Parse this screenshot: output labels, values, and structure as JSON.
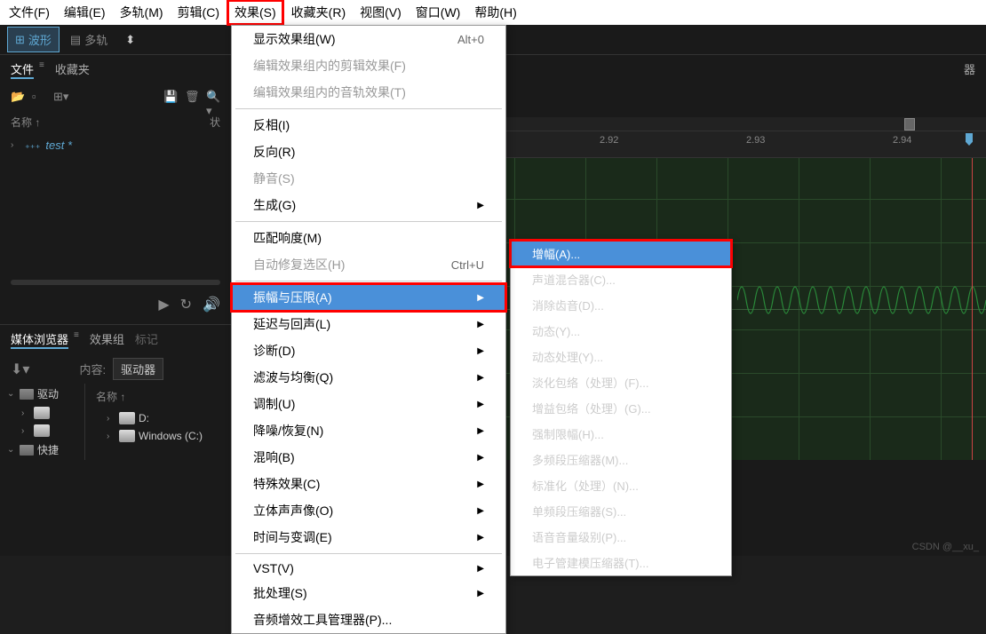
{
  "menubar": {
    "items": [
      {
        "label": "文件(F)"
      },
      {
        "label": "编辑(E)"
      },
      {
        "label": "多轨(M)"
      },
      {
        "label": "剪辑(C)"
      },
      {
        "label": "效果(S)",
        "highlighted": true
      },
      {
        "label": "收藏夹(R)"
      },
      {
        "label": "视图(V)"
      },
      {
        "label": "窗口(W)"
      },
      {
        "label": "帮助(H)"
      }
    ]
  },
  "toolbar": {
    "waveform_label": "波形",
    "multitrack_label": "多轨"
  },
  "files_panel": {
    "tab_files": "文件",
    "tab_favorites": "收藏夹",
    "name_header": "名称 ↑",
    "status_header": "状",
    "file_name": "test *",
    "expand": "›"
  },
  "browser": {
    "tab_media": "媒体浏览器",
    "tab_effects": "效果组",
    "tab_markers": "标记",
    "download_icon": "download",
    "content_label": "内容:",
    "content_value": "驱动器",
    "name_header": "名称 ↑",
    "tree": {
      "drivers_label": "驱动",
      "d_label": "D:",
      "c_label": "Windows (C:)",
      "shortcuts_label": "快捷"
    }
  },
  "editor": {
    "panel_label": "器",
    "ruler_ticks": [
      "2.92",
      "2.93",
      "2.94"
    ]
  },
  "effects_menu": {
    "items": [
      {
        "label": "显示效果组(W)",
        "accel": "Alt+0"
      },
      {
        "label": "编辑效果组内的剪辑效果(F)",
        "disabled": true
      },
      {
        "label": "编辑效果组内的音轨效果(T)",
        "disabled": true
      },
      {
        "sep": true
      },
      {
        "label": "反相(I)"
      },
      {
        "label": "反向(R)"
      },
      {
        "label": "静音(S)",
        "disabled": true
      },
      {
        "label": "生成(G)",
        "arrow": true
      },
      {
        "sep": true
      },
      {
        "label": "匹配响度(M)"
      },
      {
        "label": "自动修复选区(H)",
        "accel": "Ctrl+U",
        "disabled": true
      },
      {
        "sep": true
      },
      {
        "label": "振幅与压限(A)",
        "arrow": true,
        "highlighted": true,
        "redbox": true
      },
      {
        "label": "延迟与回声(L)",
        "arrow": true
      },
      {
        "label": "诊断(D)",
        "arrow": true
      },
      {
        "label": "滤波与均衡(Q)",
        "arrow": true
      },
      {
        "label": "调制(U)",
        "arrow": true
      },
      {
        "label": "降噪/恢复(N)",
        "arrow": true
      },
      {
        "label": "混响(B)",
        "arrow": true
      },
      {
        "label": "特殊效果(C)",
        "arrow": true
      },
      {
        "label": "立体声声像(O)",
        "arrow": true
      },
      {
        "label": "时间与变调(E)",
        "arrow": true
      },
      {
        "sep": true
      },
      {
        "label": "VST(V)",
        "arrow": true
      },
      {
        "label": "批处理(S)",
        "arrow": true
      },
      {
        "label": "音频增效工具管理器(P)..."
      }
    ]
  },
  "submenu": {
    "items": [
      {
        "label": "增幅(A)...",
        "highlighted": true,
        "redbox": true
      },
      {
        "label": "声道混合器(C)..."
      },
      {
        "label": "消除齿音(D)..."
      },
      {
        "label": "动态(Y)..."
      },
      {
        "label": "动态处理(Y)..."
      },
      {
        "label": "淡化包络（处理）(F)..."
      },
      {
        "label": "增益包络（处理）(G)..."
      },
      {
        "label": "强制限幅(H)..."
      },
      {
        "label": "多频段压缩器(M)..."
      },
      {
        "label": "标准化（处理）(N)..."
      },
      {
        "label": "单频段压缩器(S)..."
      },
      {
        "label": "语音音量级别(P)..."
      },
      {
        "label": "电子管建模压缩器(T)..."
      }
    ]
  },
  "watermark": "CSDN @__xu_"
}
